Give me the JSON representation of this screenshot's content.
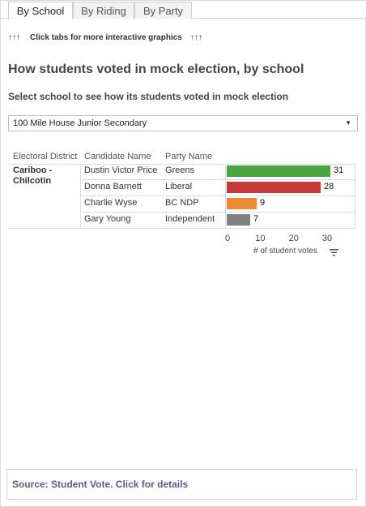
{
  "tabs": [
    {
      "label": "By School",
      "active": true
    },
    {
      "label": "By Riding",
      "active": false
    },
    {
      "label": "By Party",
      "active": false
    }
  ],
  "hint": {
    "arrows": "↑↑↑",
    "text": "Click tabs for more interactive graphics"
  },
  "title": "How students voted in mock election, by school",
  "subtitle": "Select school to see how its students voted in mock election",
  "school_select": {
    "selected": "100 Mile House Junior Secondary"
  },
  "table": {
    "headers": {
      "district": "Electoral District",
      "candidate": "Candidate Name",
      "party": "Party Name"
    },
    "district_lines": [
      "Cariboo -",
      "Chilcotin"
    ],
    "rows": [
      {
        "candidate": "Dustin Victor Price",
        "party": "Greens",
        "votes": 31,
        "color": "#4aa63f"
      },
      {
        "candidate": "Donna Barnett",
        "party": "Liberal",
        "votes": 28,
        "color": "#c8393a"
      },
      {
        "candidate": "Charlie Wyse",
        "party": "BC NDP",
        "votes": 9,
        "color": "#ef8a32"
      },
      {
        "candidate": "Gary Young",
        "party": "Independent",
        "votes": 7,
        "color": "#808080"
      }
    ]
  },
  "chart_data": {
    "type": "bar",
    "orientation": "horizontal",
    "categories": [
      "Dustin Victor Price",
      "Donna Barnett",
      "Charlie Wyse",
      "Gary Young"
    ],
    "values": [
      31,
      28,
      9,
      7
    ],
    "colors": [
      "#4aa63f",
      "#c8393a",
      "#ef8a32",
      "#808080"
    ],
    "xlabel": "# of student votes",
    "xticks": [
      "0",
      "10",
      "20",
      "30"
    ],
    "xlim": [
      0,
      33
    ]
  },
  "source": {
    "text": "Source: Student Vote. Click for details"
  }
}
